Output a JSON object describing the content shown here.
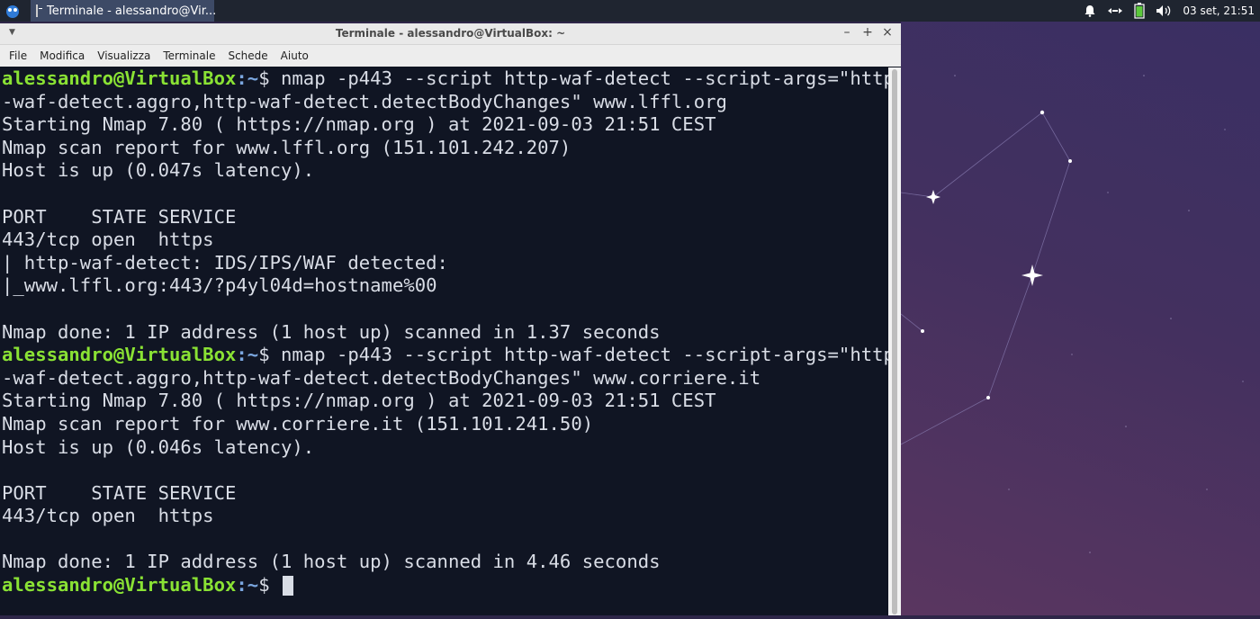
{
  "panel": {
    "task_title": "Terminale - alessandro@Vir...",
    "clock": "03 set, 21:51",
    "icons": [
      "whisker-menu-icon",
      "terminal-icon",
      "bell-icon",
      "network-icon",
      "battery-icon",
      "volume-icon"
    ]
  },
  "window": {
    "title": "Terminale - alessandro@VirtualBox: ~",
    "controls": {
      "minimize": "–",
      "maximize": "+",
      "close": "×"
    },
    "menu": [
      "File",
      "Modifica",
      "Visualizza",
      "Terminale",
      "Schede",
      "Aiuto"
    ]
  },
  "terminal": {
    "prompt_user": "alessandro@VirtualBox",
    "prompt_path": ":~",
    "prompt_sym": "$",
    "lines": [
      {
        "type": "cmd",
        "text": " nmap -p443 --script http-waf-detect --script-args=\"http"
      },
      {
        "type": "out",
        "text": "-waf-detect.aggro,http-waf-detect.detectBodyChanges\" www.lffl.org"
      },
      {
        "type": "out",
        "text": "Starting Nmap 7.80 ( https://nmap.org ) at 2021-09-03 21:51 CEST"
      },
      {
        "type": "out",
        "text": "Nmap scan report for www.lffl.org (151.101.242.207)"
      },
      {
        "type": "out",
        "text": "Host is up (0.047s latency)."
      },
      {
        "type": "out",
        "text": ""
      },
      {
        "type": "out",
        "text": "PORT    STATE SERVICE"
      },
      {
        "type": "out",
        "text": "443/tcp open  https"
      },
      {
        "type": "out",
        "text": "| http-waf-detect: IDS/IPS/WAF detected:"
      },
      {
        "type": "out",
        "text": "|_www.lffl.org:443/?p4yl04d=hostname%00"
      },
      {
        "type": "out",
        "text": ""
      },
      {
        "type": "out",
        "text": "Nmap done: 1 IP address (1 host up) scanned in 1.37 seconds"
      },
      {
        "type": "cmd",
        "text": " nmap -p443 --script http-waf-detect --script-args=\"http"
      },
      {
        "type": "out",
        "text": "-waf-detect.aggro,http-waf-detect.detectBodyChanges\" www.corriere.it"
      },
      {
        "type": "out",
        "text": "Starting Nmap 7.80 ( https://nmap.org ) at 2021-09-03 21:51 CEST"
      },
      {
        "type": "out",
        "text": "Nmap scan report for www.corriere.it (151.101.241.50)"
      },
      {
        "type": "out",
        "text": "Host is up (0.046s latency)."
      },
      {
        "type": "out",
        "text": ""
      },
      {
        "type": "out",
        "text": "PORT    STATE SERVICE"
      },
      {
        "type": "out",
        "text": "443/tcp open  https"
      },
      {
        "type": "out",
        "text": ""
      },
      {
        "type": "out",
        "text": "Nmap done: 1 IP address (1 host up) scanned in 4.46 seconds"
      },
      {
        "type": "cmd",
        "text": " ",
        "cursor": true
      }
    ]
  },
  "colors": {
    "prompt_user": "#8ae234",
    "prompt_path": "#7ba7e0",
    "terminal_bg": "#101523",
    "text": "#d9dde6"
  }
}
